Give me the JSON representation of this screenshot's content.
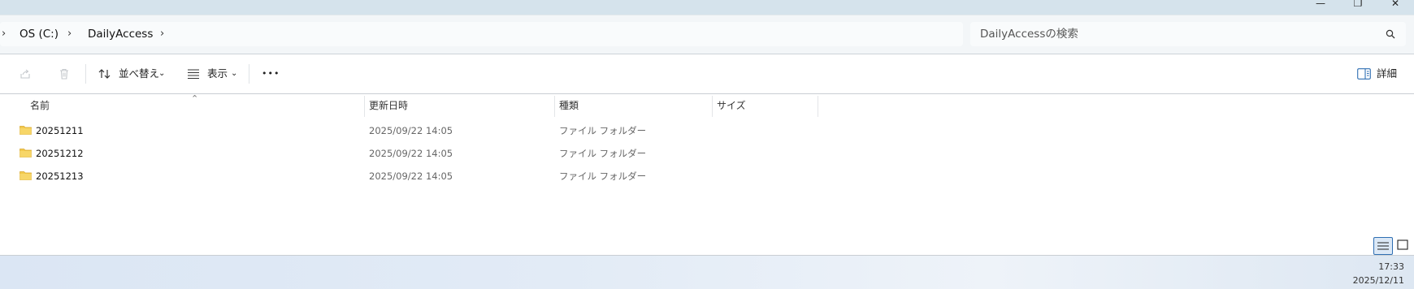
{
  "window": {
    "minimize_glyph": "—",
    "restore_glyph": "❐",
    "close_glyph": "✕"
  },
  "address": {
    "breadcrumbs": [
      "OS (C:)",
      "DailyAccess"
    ]
  },
  "search": {
    "placeholder": "DailyAccessの検索"
  },
  "commandbar": {
    "sort_label": "並べ替え",
    "view_label": "表示",
    "more_glyph": "•••",
    "details_label": "詳細"
  },
  "columns": {
    "name": "名前",
    "modified": "更新日時",
    "type": "種類",
    "size": "サイズ"
  },
  "files": [
    {
      "name": "20251211",
      "modified": "2025/09/22 14:05",
      "type": "ファイル フォルダー",
      "size": ""
    },
    {
      "name": "20251212",
      "modified": "2025/09/22 14:05",
      "type": "ファイル フォルダー",
      "size": ""
    },
    {
      "name": "20251213",
      "modified": "2025/09/22 14:05",
      "type": "ファイル フォルダー",
      "size": ""
    }
  ],
  "taskbar": {
    "time": "17:33",
    "date": "2025/12/11"
  },
  "colors": {
    "folder": "#f2c94c",
    "accent": "#2f6fb3"
  }
}
